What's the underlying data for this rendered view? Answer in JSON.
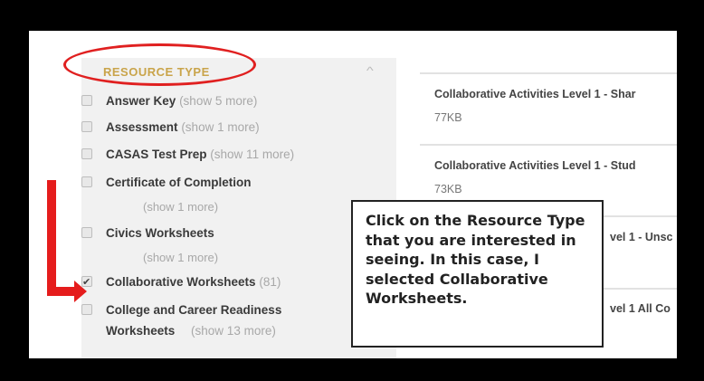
{
  "sidebar": {
    "title": "RESOURCE TYPE",
    "items": [
      {
        "label": "Answer Key",
        "more": "(show 5 more)",
        "checked": false
      },
      {
        "label": "Assessment",
        "more": "(show 1 more)",
        "checked": false
      },
      {
        "label": "CASAS Test Prep",
        "more": "(show 11 more)",
        "checked": false
      },
      {
        "label": "Certificate of Completion",
        "more": "(show 1 more)",
        "checked": false
      },
      {
        "label": "Civics Worksheets",
        "more": "(show 1 more)",
        "checked": false
      },
      {
        "label": "Collaborative Worksheets",
        "more": "(81)",
        "checked": true
      },
      {
        "label": "College and Career Readiness",
        "label2": "Worksheets",
        "more": "(show 13 more)",
        "checked": false
      }
    ]
  },
  "results": [
    {
      "title": "Collaborative Activities Level 1 - Shar",
      "size": "77KB"
    },
    {
      "title": "Collaborative Activities Level 1 - Stud",
      "size": "73KB"
    },
    {
      "title": "vel 1 - Unsc"
    },
    {
      "title": "vel 1 All Co"
    }
  ],
  "callout": {
    "text": "Click on the Resource Type that you are interested in seeing.  In this case, I selected Collaborative Worksheets."
  },
  "colors": {
    "annotation_red": "#e51c1c",
    "title_gold": "#c9a44a"
  }
}
